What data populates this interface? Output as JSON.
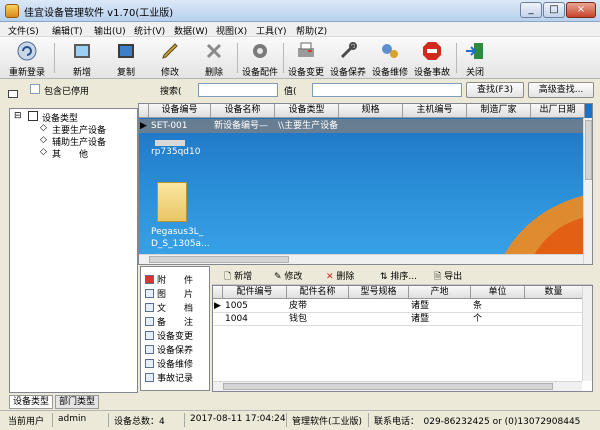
{
  "window": {
    "title": "佳宜设备管理软件 v1.70(工业版)",
    "min_label": "_",
    "max_label": "□",
    "close_label": "×"
  },
  "menu": [
    "文件(S)",
    "编辑(T)",
    "输出(U)",
    "统计(V)",
    "数据(W)",
    "视图(X)",
    "工具(Y)",
    "帮助(Z)"
  ],
  "toolbar": {
    "relogin": "重新登录",
    "add": "新增",
    "copy": "复制",
    "edit": "修改",
    "delete": "删除",
    "parts": "设备配件",
    "change": "设备变更",
    "maintain": "设备保养",
    "repair": "设备维修",
    "accident": "设备事故",
    "close": "关闭"
  },
  "filter": {
    "include_disabled": "包含已停用",
    "search_label": "搜索(",
    "value_label": "值(",
    "search_value": "",
    "value_value": "",
    "find_button": "查找(F3)",
    "advanced_button": "高级查找..."
  },
  "tree": {
    "root": "设备类型",
    "items": [
      "主要生产设备",
      "辅助生产设备",
      "其　　他"
    ],
    "tabs": [
      "设备类型",
      "部门类型"
    ]
  },
  "grid": {
    "columns": [
      "设备编号",
      "设备名称",
      "设备类型",
      "规格",
      "主机编号",
      "制造厂家",
      "出厂日期"
    ],
    "rows": [
      {
        "code": "SET-001",
        "name": "新设备编号—",
        "type": "\\\\主要生产设备"
      }
    ],
    "desktop_items": [
      "rp735qd10",
      "Pegasus3L_",
      "D_S_1305a..."
    ]
  },
  "sublist": [
    "附　　件",
    "图　　片",
    "文　　档",
    "备　　注",
    "设备变更",
    "设备保养",
    "设备维修",
    "事故记录"
  ],
  "subtoolbar": [
    "新增",
    "修改",
    "删除",
    "排序...",
    "导出"
  ],
  "subgrid": {
    "columns": [
      "配件编号",
      "配件名称",
      "型号规格",
      "产地",
      "单位",
      "数量"
    ],
    "rows": [
      {
        "code": "1005",
        "name": "皮带",
        "spec": "",
        "origin": "诸暨",
        "unit": "条",
        "qty": ""
      },
      {
        "code": "1004",
        "name": "钱包",
        "spec": "",
        "origin": "诸暨",
        "unit": "个",
        "qty": ""
      }
    ]
  },
  "status": {
    "user_label": "当前用户",
    "user": "admin",
    "total": "设备总数：4",
    "datetime": "2017-08-11 17:04:24",
    "product": "管理软件(工业版)",
    "contact": "联系电话：　029-86232425 or (0)13072908445"
  }
}
